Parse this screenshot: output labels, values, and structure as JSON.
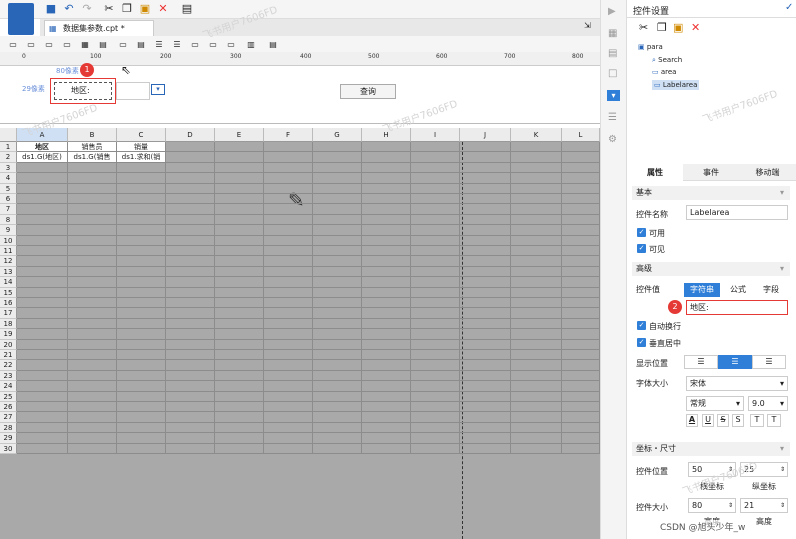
{
  "document_tab": {
    "label": "数据集参数.cpt *"
  },
  "ruler_marks": [
    "0",
    "100",
    "200",
    "300",
    "400",
    "500",
    "600",
    "700",
    "800"
  ],
  "param_pane": {
    "width_label": "80像素",
    "height_label": "29像素",
    "area_label": "地区:",
    "query_button": "查询"
  },
  "columns": [
    "A",
    "B",
    "C",
    "D",
    "E",
    "F",
    "G",
    "H",
    "I",
    "J",
    "K",
    "L"
  ],
  "rows": [
    "1",
    "2",
    "3",
    "4",
    "5",
    "6",
    "7",
    "8",
    "9",
    "10",
    "11",
    "12",
    "13",
    "14",
    "15",
    "16",
    "17",
    "18",
    "19",
    "20",
    "21",
    "22",
    "23",
    "24",
    "25",
    "26",
    "27",
    "28",
    "29",
    "30"
  ],
  "cells": {
    "a1": "地区",
    "b1": "销售员",
    "c1": "销量",
    "a2": "ds1.G(地区)",
    "b2": "ds1.G(销售",
    "c2": "ds1.求和(销"
  },
  "panel": {
    "title": "控件设置",
    "tree": {
      "root": "para",
      "items": [
        "Search",
        "area",
        "Labelarea"
      ]
    },
    "tabs": [
      "属性",
      "事件",
      "移动端"
    ],
    "basic": "基本",
    "name_label": "控件名称",
    "name_value": "Labelarea",
    "enabled": "可用",
    "visible": "可见",
    "advanced": "高级",
    "value_label": "控件值",
    "value_modes": [
      "字符串",
      "公式",
      "字段"
    ],
    "value_text": "地区:",
    "wrap": "自动换行",
    "vcenter": "垂直居中",
    "align_label": "显示位置",
    "font_label": "字体大小",
    "font_name": "宋体",
    "font_style": "常规",
    "font_size": "9.0",
    "style_buttons": [
      "A",
      "U",
      "S",
      "S",
      "T",
      "T"
    ],
    "coord_section": "坐标・尺寸",
    "pos_label": "控件位置",
    "pos_x": "50",
    "pos_y": "25",
    "x_caption": "横坐标",
    "y_caption": "纵坐标",
    "size_label": "控件大小",
    "size_w": "80",
    "size_h": "21",
    "w_caption": "宽度",
    "h_caption": "高度"
  },
  "badges": [
    "1",
    "2"
  ],
  "watermarks": [
    "飞书用户7606FD",
    "飞书用户7606FD",
    "飞书用户7606FD",
    "飞书用户7606FD",
    "飞书用户7606FD"
  ],
  "footer_credit": "CSDN @旭头少年_w"
}
